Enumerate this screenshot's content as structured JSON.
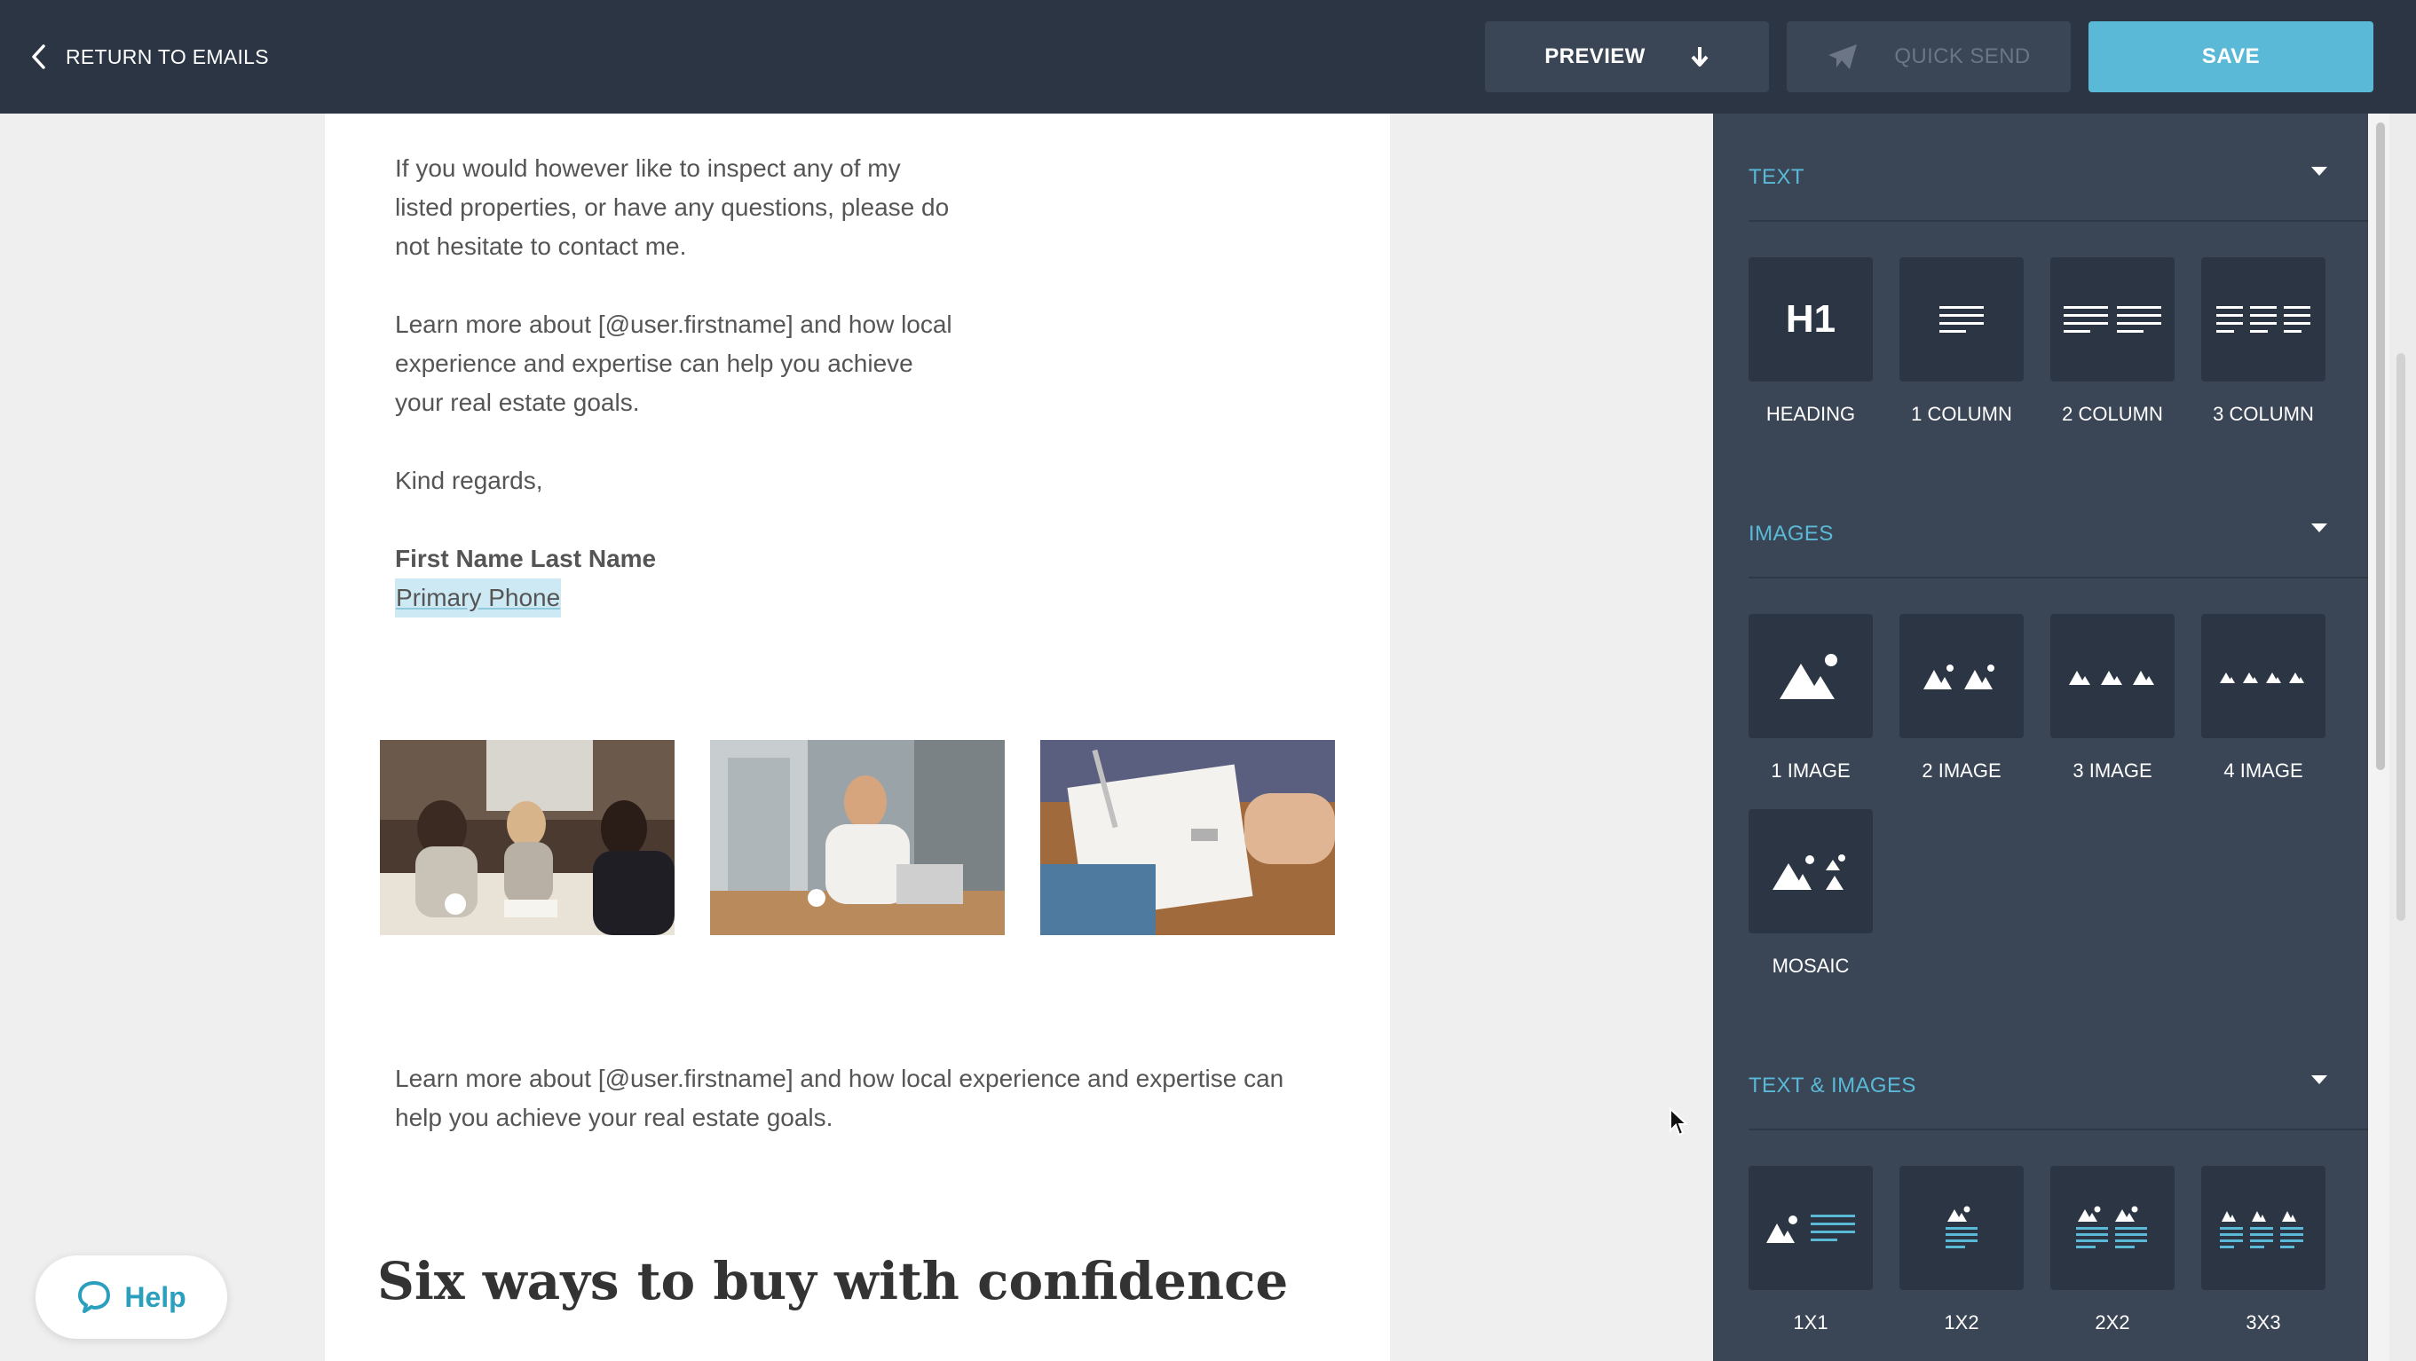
{
  "topbar": {
    "back_label": "RETURN TO EMAILS",
    "preview_label": "PREVIEW",
    "quick_send_label": "QUICK SEND",
    "save_label": "SAVE"
  },
  "email": {
    "para1": "If you would however like to inspect any of my listed properties, or have any questions, please do not hesitate to contact me.",
    "para2": "Learn more about [@user.firstname] and how local experience and expertise can help you achieve your real estate goals.",
    "closing": "Kind regards,",
    "signature_name": "First Name Last Name",
    "signature_phone": "Primary Phone",
    "para3": "Learn more about [@user.firstname] and how local experience and expertise can help you achieve your real estate goals.",
    "heading": "Six ways to buy with confidence"
  },
  "sidebar": {
    "sections": [
      {
        "title": "TEXT",
        "items": [
          "HEADING",
          "1 COLUMN",
          "2 COLUMN",
          "3 COLUMN"
        ],
        "h1_glyph": "H1"
      },
      {
        "title": "IMAGES",
        "items": [
          "1 IMAGE",
          "2 IMAGE",
          "3 IMAGE",
          "4 IMAGE",
          "MOSAIC"
        ]
      },
      {
        "title": "TEXT & IMAGES",
        "items": [
          "1X1",
          "1X2",
          "2X2",
          "3X3"
        ]
      }
    ]
  },
  "help": {
    "label": "Help"
  },
  "colors": {
    "accent": "#5ab9d6",
    "topbar": "#2b3544",
    "sidebar": "#3a4556",
    "tile": "#2b3544"
  }
}
